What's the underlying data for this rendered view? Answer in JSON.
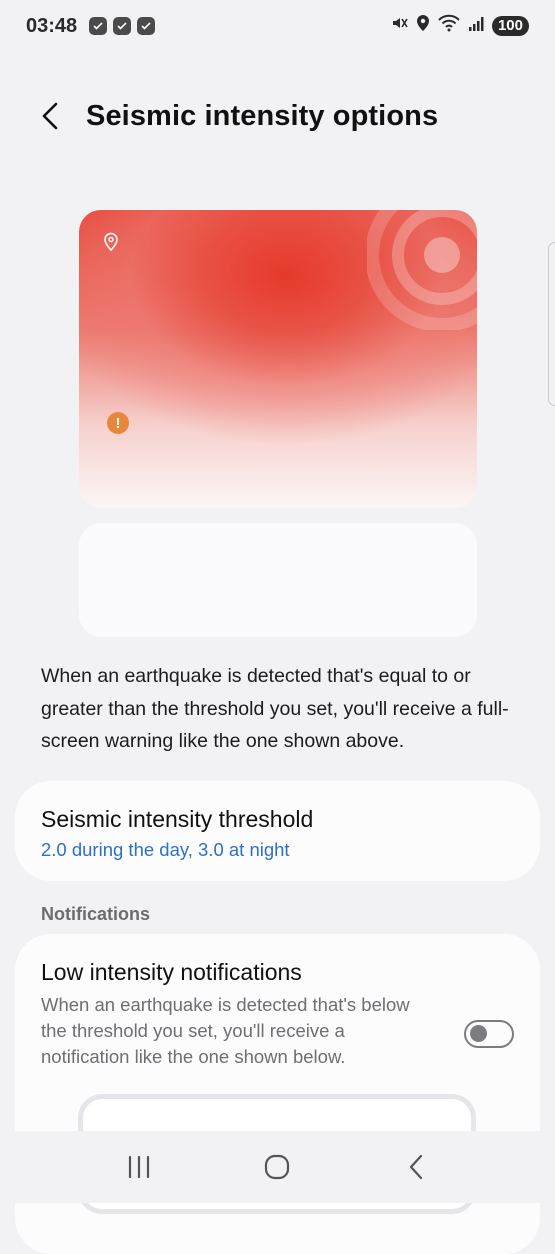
{
  "status_bar": {
    "time": "03:48",
    "battery": "100"
  },
  "header": {
    "title": "Seismic intensity options"
  },
  "description": "When an earthquake is detected that's equal to or greater than the threshold you set, you'll receive a full-screen warning like the one shown above.",
  "threshold": {
    "title": "Seismic intensity threshold",
    "value": "2.0 during the day, 3.0 at night"
  },
  "section_notifications": "Notifications",
  "low_intensity": {
    "title": "Low intensity notifications",
    "description": "When an earthquake is detected that's below the threshold you set, you'll receive a notification like the one shown below.",
    "enabled": false
  },
  "colors": {
    "accent": "#2f6fc6",
    "alert_red": "#e64a3c",
    "alert_orange": "#e8873b"
  },
  "icons": [
    "back-chevron-icon",
    "location-pin-icon",
    "alert-icon",
    "recent-apps-icon",
    "home-icon",
    "nav-back-icon"
  ]
}
